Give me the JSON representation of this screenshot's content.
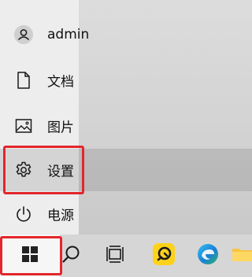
{
  "start_menu": {
    "items": [
      {
        "label": "admin",
        "icon": "user-icon"
      },
      {
        "label": "文档",
        "icon": "document-icon"
      },
      {
        "label": "图片",
        "icon": "picture-icon"
      },
      {
        "label": "设置",
        "icon": "gear-icon",
        "selected": true
      },
      {
        "label": "电源",
        "icon": "power-icon"
      }
    ]
  },
  "taskbar": {
    "items": [
      {
        "name": "start",
        "icon": "windows-logo-icon"
      },
      {
        "name": "search",
        "icon": "search-icon"
      },
      {
        "name": "task-view",
        "icon": "task-view-icon"
      },
      {
        "name": "app",
        "icon": "yellow-app-icon"
      },
      {
        "name": "edge",
        "icon": "edge-icon"
      },
      {
        "name": "file-explorer",
        "icon": "folder-icon"
      }
    ]
  },
  "colors": {
    "highlight": "#e3262b",
    "selected_bg": "#d5d5d5"
  }
}
